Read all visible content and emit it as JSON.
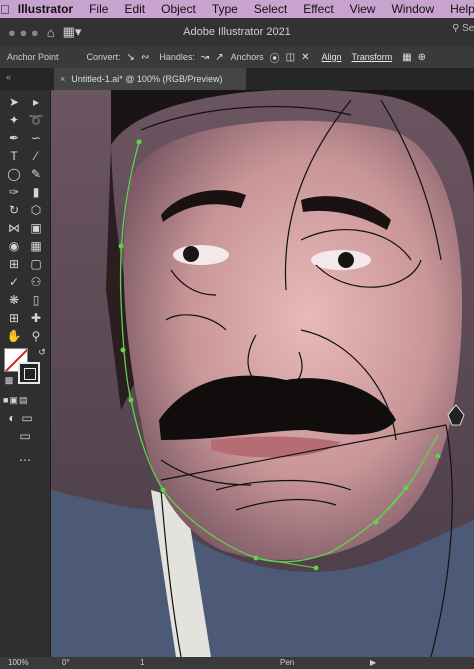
{
  "menubar": {
    "apple": "",
    "items": [
      "Illustrator",
      "File",
      "Edit",
      "Object",
      "Type",
      "Select",
      "Effect",
      "View",
      "Window",
      "Help"
    ]
  },
  "appbar": {
    "title": "Adobe Illustrator 2021",
    "search_placeholder": "Sea"
  },
  "controlbar": {
    "tool_name": "Anchor Point",
    "convert_label": "Convert:",
    "handles_label": "Handles:",
    "anchors_label": "Anchors",
    "align_label": "Align",
    "transform_label": "Transform"
  },
  "document": {
    "tab_title": "Untitled-1.ai* @ 100% (RGB/Preview)",
    "close_glyph": "×"
  },
  "status": {
    "zoom": "100%",
    "rotation": "0°",
    "artboard": "1",
    "tool": "Pen"
  },
  "colors": {
    "menubar_bg": "#c9a3cf",
    "path_selected": "#5fd34c",
    "path_stroke": "#111111"
  }
}
